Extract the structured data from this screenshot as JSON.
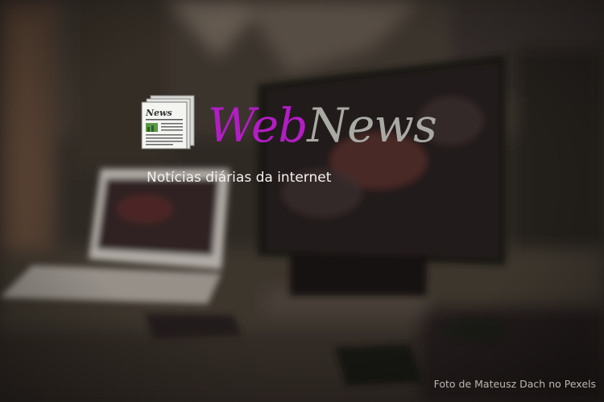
{
  "site": {
    "name_part1": "Web",
    "name_part2": "News",
    "tagline": "Notícias diárias da internet",
    "logo_icon": "newspaper-icon",
    "logo_icon_text": "News"
  },
  "photo_credit": "Foto de Mateusz Dach no Pexels",
  "colors": {
    "brand_primary": "#b21dc4",
    "brand_secondary": "#a9aaa4",
    "tagline": "#f4f1ee",
    "credit": "#bdb7b1"
  }
}
